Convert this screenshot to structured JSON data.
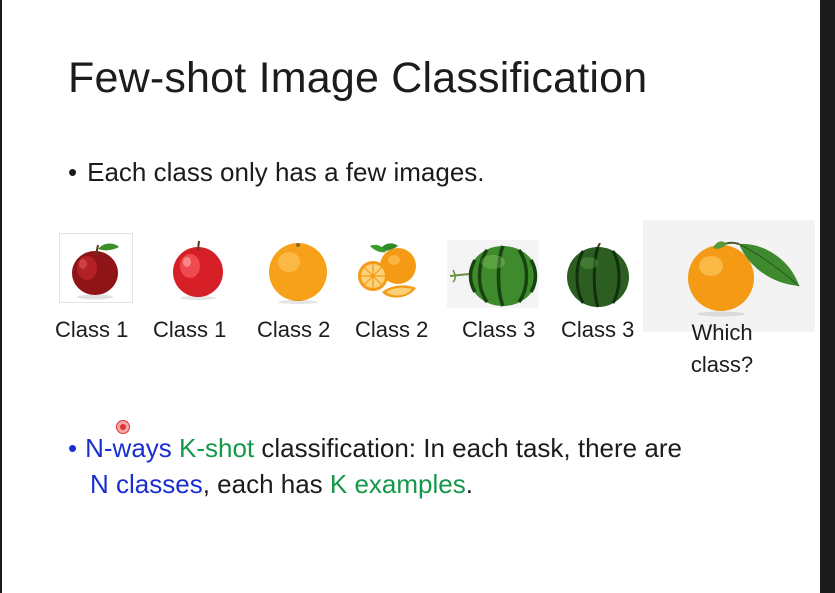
{
  "slide": {
    "title": "Few-shot Image Classification",
    "bullet1": {
      "marker": "•",
      "text": "Each class only has a few images."
    },
    "images": [
      {
        "icon": "red-apple-1",
        "label": "Class 1"
      },
      {
        "icon": "red-apple-2",
        "label": "Class 1"
      },
      {
        "icon": "orange-1",
        "label": "Class 2"
      },
      {
        "icon": "orange-sliced",
        "label": "Class 2"
      },
      {
        "icon": "watermelon-1",
        "label": "Class 3"
      },
      {
        "icon": "watermelon-2",
        "label": "Class 3"
      },
      {
        "icon": "orange-query",
        "label_line1": "Which",
        "label_line2": "class?"
      }
    ],
    "bullet2": {
      "marker": "•",
      "part1": "N-ways",
      "part2": " ",
      "part3": "K-shot",
      "part4": " classification: In each task, there are",
      "part5": "N classes",
      "part6": ", each has ",
      "part7": "K examples",
      "part8": "."
    },
    "colors": {
      "blue_text": "#1a2fd0",
      "green_text": "#14984a"
    }
  }
}
